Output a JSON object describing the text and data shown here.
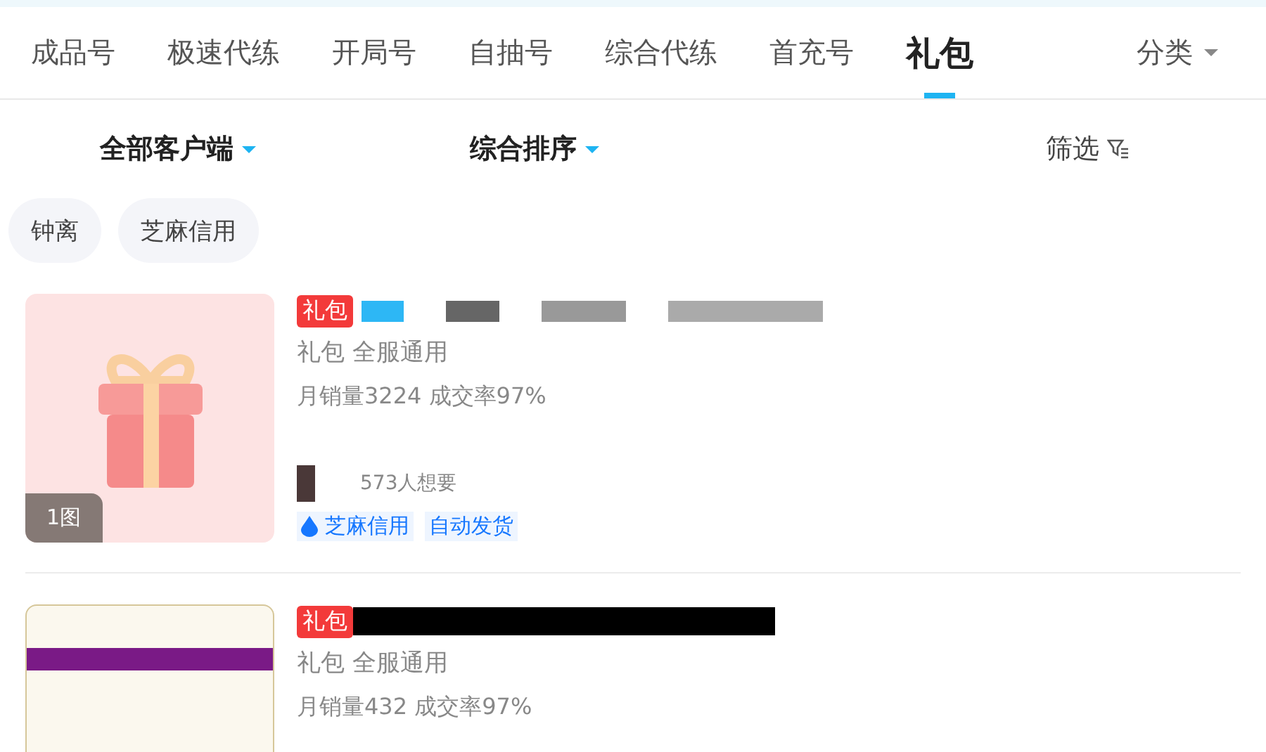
{
  "tabs": [
    {
      "label": "成品号",
      "selected": false
    },
    {
      "label": "极速代练",
      "selected": false
    },
    {
      "label": "开局号",
      "selected": false
    },
    {
      "label": "自抽号",
      "selected": false
    },
    {
      "label": "综合代练",
      "selected": false
    },
    {
      "label": "首充号",
      "selected": false
    },
    {
      "label": "礼包",
      "selected": true
    }
  ],
  "category_menu": {
    "label": "分类"
  },
  "filters": [
    {
      "label": "全部客户端",
      "kind": "dropdown"
    },
    {
      "label": "综合排序",
      "kind": "dropdown"
    },
    {
      "label": "筛选",
      "kind": "filter"
    }
  ],
  "chips": [
    "钟离",
    "芝麻信用"
  ],
  "listings": [
    {
      "kind": "gift",
      "image_count": "1图",
      "badge": "礼包",
      "subtitle": "礼包  全服通用",
      "stats": "月销量3224 成交率97%",
      "wants": "573人想要",
      "tags": [
        {
          "label": "芝麻信用",
          "kind": "credit"
        },
        {
          "label": "自动发货",
          "kind": "plain"
        }
      ]
    },
    {
      "kind": "poster",
      "badge": "礼包",
      "subtitle": "礼包  全服通用",
      "stats": "月销量432 成交率97%"
    }
  ]
}
